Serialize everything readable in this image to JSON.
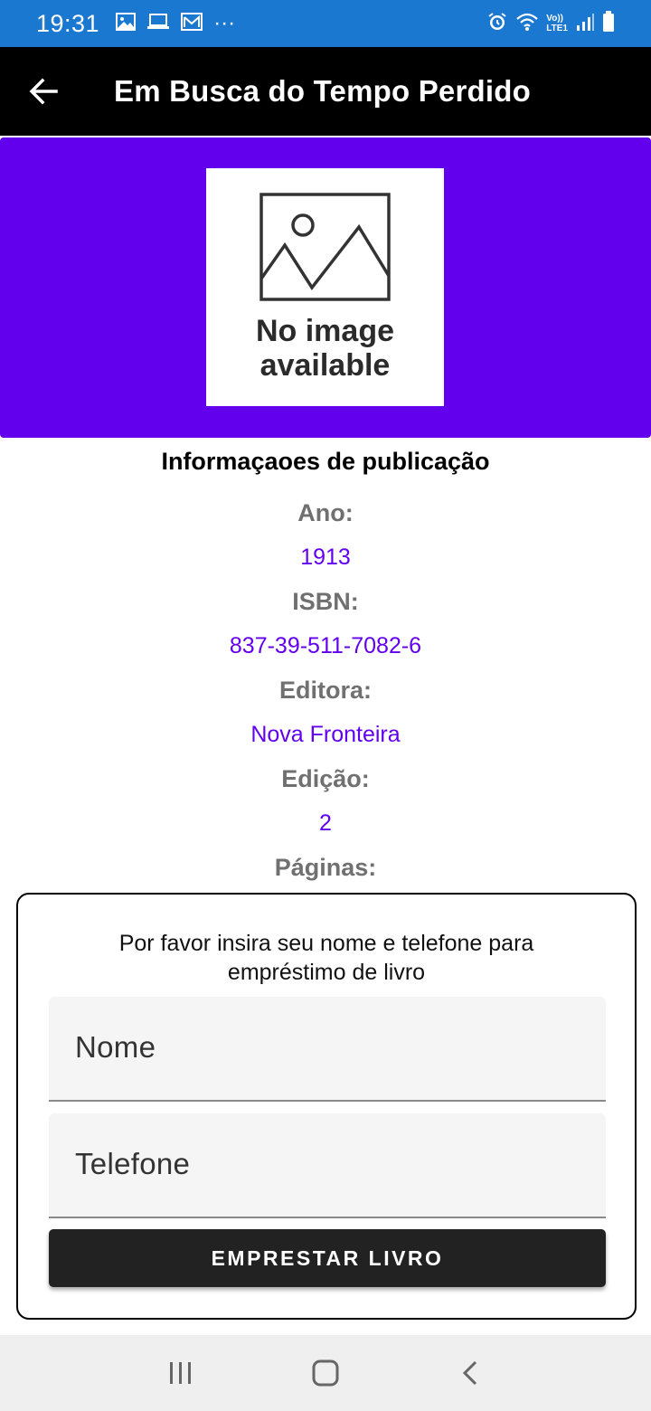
{
  "status_bar": {
    "time": "19:31",
    "icons": [
      "image-icon",
      "laptop-icon",
      "mail-icon",
      "more-dots-icon",
      "alarm-icon",
      "wifi-icon",
      "volte-icon",
      "signal-icon",
      "battery-icon"
    ],
    "volte_label": "Vo))",
    "lte_label": "LTE1",
    "more": "···"
  },
  "app_bar": {
    "title": "Em Busca do Tempo Perdido"
  },
  "cover": {
    "placeholder_text": "No image available",
    "background": "#6200ee"
  },
  "publication": {
    "heading": "Informaçaoes de publicação",
    "fields": [
      {
        "label": "Ano:",
        "value": "1913"
      },
      {
        "label": "ISBN:",
        "value": "837-39-511-7082-6"
      },
      {
        "label": "Editora:",
        "value": "Nova Fronteira"
      },
      {
        "label": "Edição:",
        "value": "2"
      },
      {
        "label": "Páginas:"
      }
    ]
  },
  "loan_dialog": {
    "prompt": "Por favor insira seu nome e telefone para empréstimo de livro",
    "name_placeholder": "Nome",
    "phone_placeholder": "Telefone",
    "button_label": "EMPRESTAR LIVRO"
  },
  "colors": {
    "accent": "#6200ee",
    "status_bar": "#1a78d1",
    "app_bar": "#000000",
    "button": "#222222"
  }
}
